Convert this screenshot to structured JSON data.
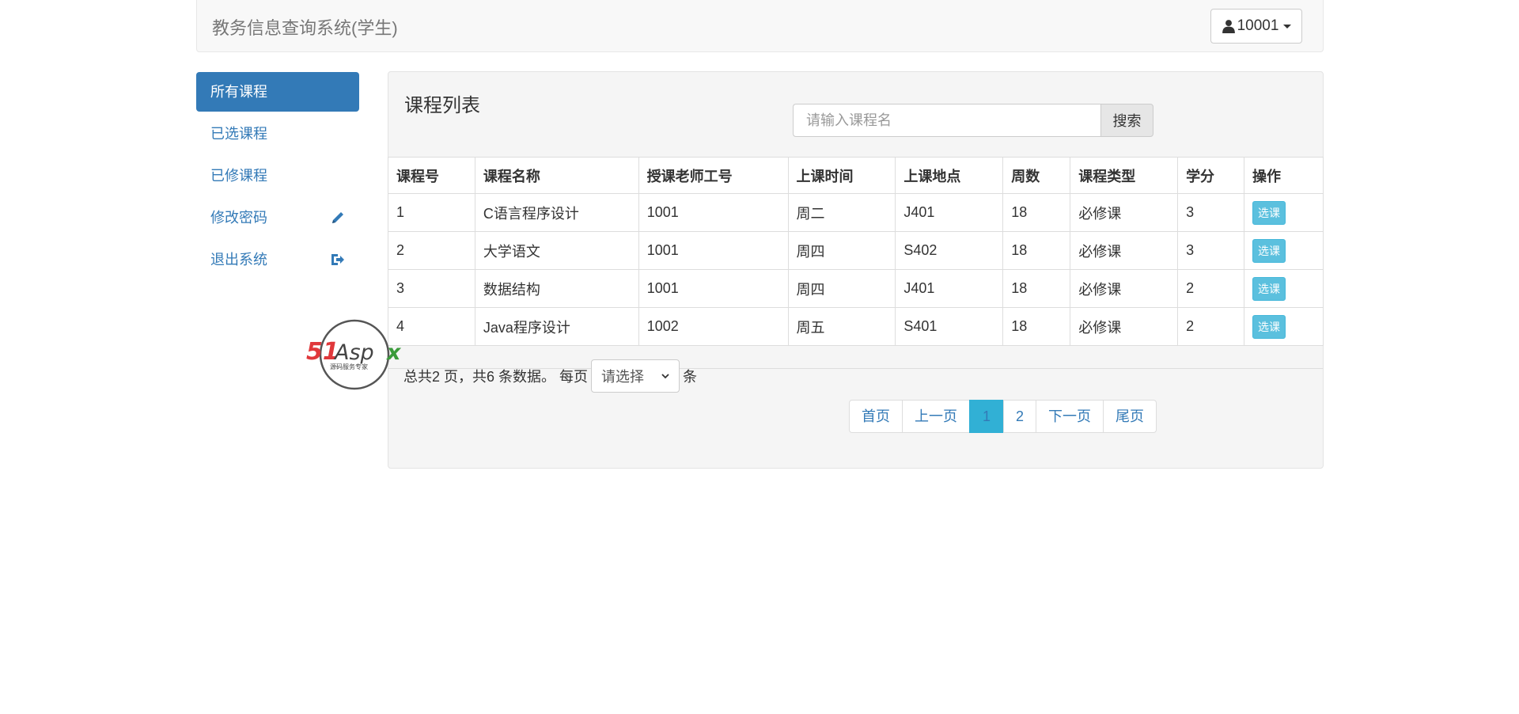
{
  "header": {
    "brand": "教务信息查询系统(学生)",
    "user_label": "10001"
  },
  "sidebar": {
    "items": [
      {
        "label": "所有课程",
        "active": true
      },
      {
        "label": "已选课程"
      },
      {
        "label": "已修课程"
      },
      {
        "label": "修改密码",
        "icon": "pencil-icon"
      },
      {
        "label": "退出系统",
        "icon": "logout-icon"
      }
    ]
  },
  "panel": {
    "title": "课程列表",
    "search": {
      "placeholder": "请输入课程名",
      "button": "搜索"
    }
  },
  "table": {
    "headers": [
      "课程号",
      "课程名称",
      "授课老师工号",
      "上课时间",
      "上课地点",
      "周数",
      "课程类型",
      "学分",
      "操作"
    ],
    "rows": [
      {
        "id": "1",
        "name": "C语言程序设计",
        "teacher": "1001",
        "time": "周二",
        "place": "J401",
        "weeks": "18",
        "type": "必修课",
        "credit": "3",
        "action": "选课"
      },
      {
        "id": "2",
        "name": "大学语文",
        "teacher": "1001",
        "time": "周四",
        "place": "S402",
        "weeks": "18",
        "type": "必修课",
        "credit": "3",
        "action": "选课"
      },
      {
        "id": "3",
        "name": "数据结构",
        "teacher": "1001",
        "time": "周四",
        "place": "J401",
        "weeks": "18",
        "type": "必修课",
        "credit": "2",
        "action": "选课"
      },
      {
        "id": "4",
        "name": "Java程序设计",
        "teacher": "1002",
        "time": "周五",
        "place": "S401",
        "weeks": "18",
        "type": "必修课",
        "credit": "2",
        "action": "选课"
      }
    ]
  },
  "summary": {
    "text": "总共2 页，共6 条数据。 每页",
    "select_value": "请选择",
    "suffix": "条"
  },
  "pagination": {
    "first": "首页",
    "prev": "上一页",
    "pages": [
      "1",
      "2"
    ],
    "current": "1",
    "next": "下一页",
    "last": "尾页"
  },
  "watermark": {
    "brand": "51Aspx",
    "tagline": "源码服务专家"
  },
  "colors": {
    "primary": "#337ab7",
    "info": "#5bc0de",
    "active_page": "#31b0d5",
    "panel_bg": "#f5f5f5"
  }
}
